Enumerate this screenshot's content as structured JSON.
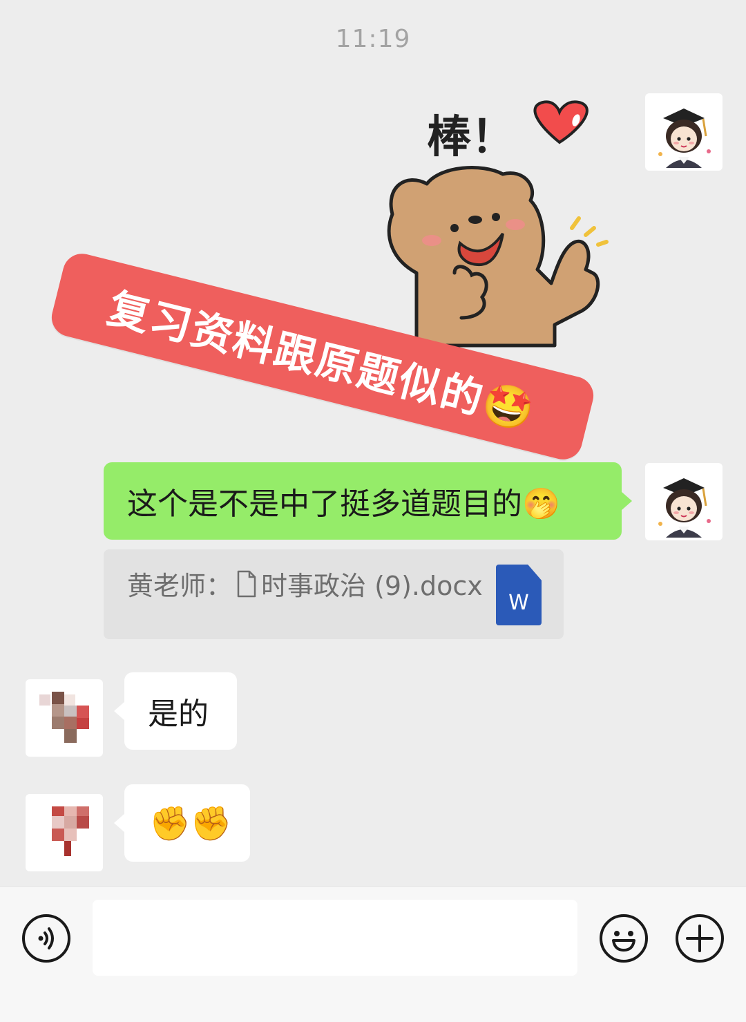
{
  "header": {
    "time": "11:19"
  },
  "sticker": {
    "caption": "棒！"
  },
  "overlay_banner": {
    "text": "复习资料跟原题似的🤩"
  },
  "messages": [
    {
      "side": "right",
      "text": "这个是不是中了挺多道题目的🤭"
    },
    {
      "side": "left",
      "text": "是的"
    },
    {
      "side": "left",
      "text": "✊✊"
    }
  ],
  "quote": {
    "sender": "黄老师：",
    "file_name": "时事政治 (9).docx",
    "file_icon_letter": "W"
  },
  "colors": {
    "background": "#ededed",
    "sent_bubble": "#95ec69",
    "received_bubble": "#ffffff",
    "banner": "#ef5f5d",
    "word_icon": "#2b5ab8"
  },
  "input_bar": {
    "voice_button_icon": "voice-icon",
    "emoji_button_icon": "emoji-icon",
    "plus_button_icon": "plus-icon"
  }
}
